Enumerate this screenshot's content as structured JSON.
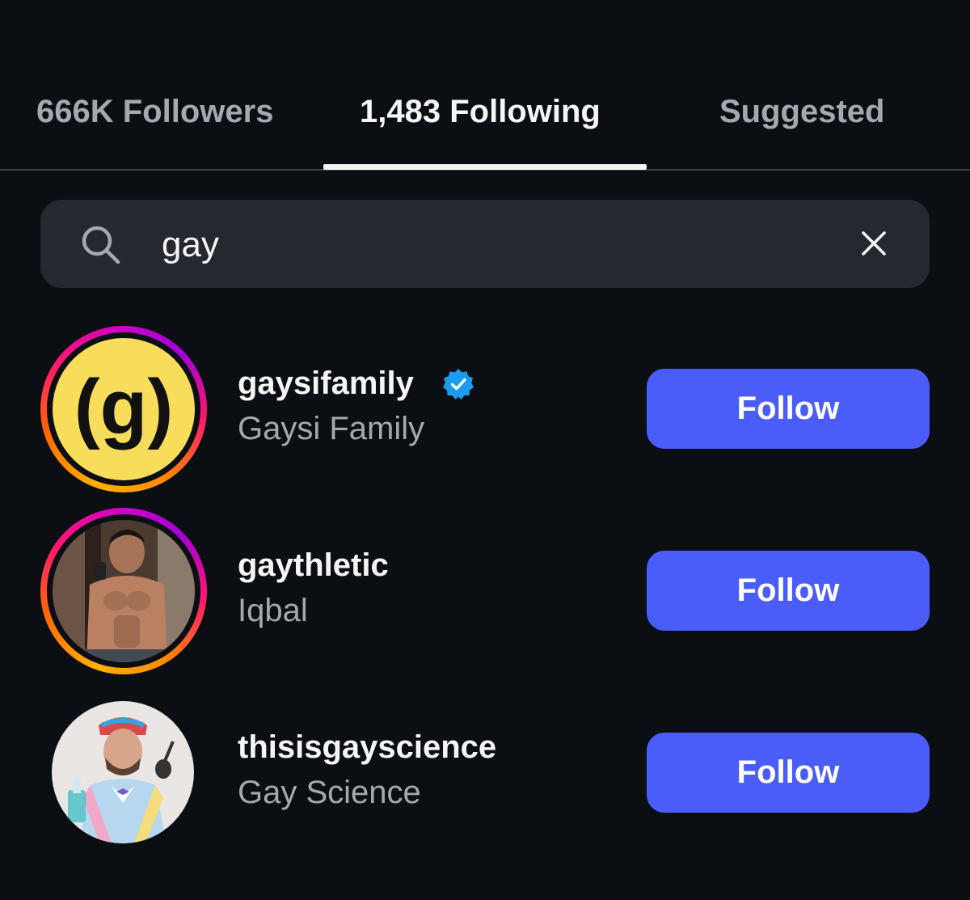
{
  "tabs": {
    "followers_label": "666K Followers",
    "following_label": "1,483 Following",
    "suggested_label": "Suggested"
  },
  "search": {
    "value": "gay",
    "icon": "search-icon",
    "clear_icon": "close-icon"
  },
  "results": [
    {
      "username": "gaysifamily",
      "full_name": "Gaysi Family",
      "verified": true,
      "has_story_ring": true,
      "avatar_text": "(g)",
      "follow_label": "Follow"
    },
    {
      "username": "gaythletic",
      "full_name": "Iqbal",
      "verified": false,
      "has_story_ring": true,
      "follow_label": "Follow"
    },
    {
      "username": "thisisgayscience",
      "full_name": "Gay Science",
      "verified": false,
      "has_story_ring": false,
      "follow_label": "Follow"
    }
  ],
  "colors": {
    "background": "#0b0e13",
    "follow_button": "#4a5df9",
    "verified_badge": "#1d9bf0",
    "search_bg": "#25292f"
  }
}
